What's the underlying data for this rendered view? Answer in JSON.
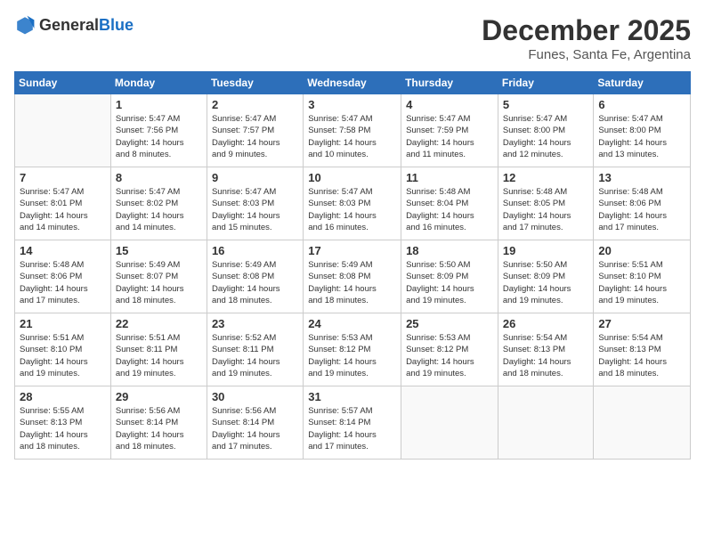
{
  "logo": {
    "general": "General",
    "blue": "Blue"
  },
  "title": "December 2025",
  "location": "Funes, Santa Fe, Argentina",
  "days_of_week": [
    "Sunday",
    "Monday",
    "Tuesday",
    "Wednesday",
    "Thursday",
    "Friday",
    "Saturday"
  ],
  "weeks": [
    [
      {
        "day": "",
        "info": ""
      },
      {
        "day": "1",
        "info": "Sunrise: 5:47 AM\nSunset: 7:56 PM\nDaylight: 14 hours\nand 8 minutes."
      },
      {
        "day": "2",
        "info": "Sunrise: 5:47 AM\nSunset: 7:57 PM\nDaylight: 14 hours\nand 9 minutes."
      },
      {
        "day": "3",
        "info": "Sunrise: 5:47 AM\nSunset: 7:58 PM\nDaylight: 14 hours\nand 10 minutes."
      },
      {
        "day": "4",
        "info": "Sunrise: 5:47 AM\nSunset: 7:59 PM\nDaylight: 14 hours\nand 11 minutes."
      },
      {
        "day": "5",
        "info": "Sunrise: 5:47 AM\nSunset: 8:00 PM\nDaylight: 14 hours\nand 12 minutes."
      },
      {
        "day": "6",
        "info": "Sunrise: 5:47 AM\nSunset: 8:00 PM\nDaylight: 14 hours\nand 13 minutes."
      }
    ],
    [
      {
        "day": "7",
        "info": "Sunrise: 5:47 AM\nSunset: 8:01 PM\nDaylight: 14 hours\nand 14 minutes."
      },
      {
        "day": "8",
        "info": "Sunrise: 5:47 AM\nSunset: 8:02 PM\nDaylight: 14 hours\nand 14 minutes."
      },
      {
        "day": "9",
        "info": "Sunrise: 5:47 AM\nSunset: 8:03 PM\nDaylight: 14 hours\nand 15 minutes."
      },
      {
        "day": "10",
        "info": "Sunrise: 5:47 AM\nSunset: 8:03 PM\nDaylight: 14 hours\nand 16 minutes."
      },
      {
        "day": "11",
        "info": "Sunrise: 5:48 AM\nSunset: 8:04 PM\nDaylight: 14 hours\nand 16 minutes."
      },
      {
        "day": "12",
        "info": "Sunrise: 5:48 AM\nSunset: 8:05 PM\nDaylight: 14 hours\nand 17 minutes."
      },
      {
        "day": "13",
        "info": "Sunrise: 5:48 AM\nSunset: 8:06 PM\nDaylight: 14 hours\nand 17 minutes."
      }
    ],
    [
      {
        "day": "14",
        "info": "Sunrise: 5:48 AM\nSunset: 8:06 PM\nDaylight: 14 hours\nand 17 minutes."
      },
      {
        "day": "15",
        "info": "Sunrise: 5:49 AM\nSunset: 8:07 PM\nDaylight: 14 hours\nand 18 minutes."
      },
      {
        "day": "16",
        "info": "Sunrise: 5:49 AM\nSunset: 8:08 PM\nDaylight: 14 hours\nand 18 minutes."
      },
      {
        "day": "17",
        "info": "Sunrise: 5:49 AM\nSunset: 8:08 PM\nDaylight: 14 hours\nand 18 minutes."
      },
      {
        "day": "18",
        "info": "Sunrise: 5:50 AM\nSunset: 8:09 PM\nDaylight: 14 hours\nand 19 minutes."
      },
      {
        "day": "19",
        "info": "Sunrise: 5:50 AM\nSunset: 8:09 PM\nDaylight: 14 hours\nand 19 minutes."
      },
      {
        "day": "20",
        "info": "Sunrise: 5:51 AM\nSunset: 8:10 PM\nDaylight: 14 hours\nand 19 minutes."
      }
    ],
    [
      {
        "day": "21",
        "info": "Sunrise: 5:51 AM\nSunset: 8:10 PM\nDaylight: 14 hours\nand 19 minutes."
      },
      {
        "day": "22",
        "info": "Sunrise: 5:51 AM\nSunset: 8:11 PM\nDaylight: 14 hours\nand 19 minutes."
      },
      {
        "day": "23",
        "info": "Sunrise: 5:52 AM\nSunset: 8:11 PM\nDaylight: 14 hours\nand 19 minutes."
      },
      {
        "day": "24",
        "info": "Sunrise: 5:53 AM\nSunset: 8:12 PM\nDaylight: 14 hours\nand 19 minutes."
      },
      {
        "day": "25",
        "info": "Sunrise: 5:53 AM\nSunset: 8:12 PM\nDaylight: 14 hours\nand 19 minutes."
      },
      {
        "day": "26",
        "info": "Sunrise: 5:54 AM\nSunset: 8:13 PM\nDaylight: 14 hours\nand 18 minutes."
      },
      {
        "day": "27",
        "info": "Sunrise: 5:54 AM\nSunset: 8:13 PM\nDaylight: 14 hours\nand 18 minutes."
      }
    ],
    [
      {
        "day": "28",
        "info": "Sunrise: 5:55 AM\nSunset: 8:13 PM\nDaylight: 14 hours\nand 18 minutes."
      },
      {
        "day": "29",
        "info": "Sunrise: 5:56 AM\nSunset: 8:14 PM\nDaylight: 14 hours\nand 18 minutes."
      },
      {
        "day": "30",
        "info": "Sunrise: 5:56 AM\nSunset: 8:14 PM\nDaylight: 14 hours\nand 17 minutes."
      },
      {
        "day": "31",
        "info": "Sunrise: 5:57 AM\nSunset: 8:14 PM\nDaylight: 14 hours\nand 17 minutes."
      },
      {
        "day": "",
        "info": ""
      },
      {
        "day": "",
        "info": ""
      },
      {
        "day": "",
        "info": ""
      }
    ]
  ]
}
